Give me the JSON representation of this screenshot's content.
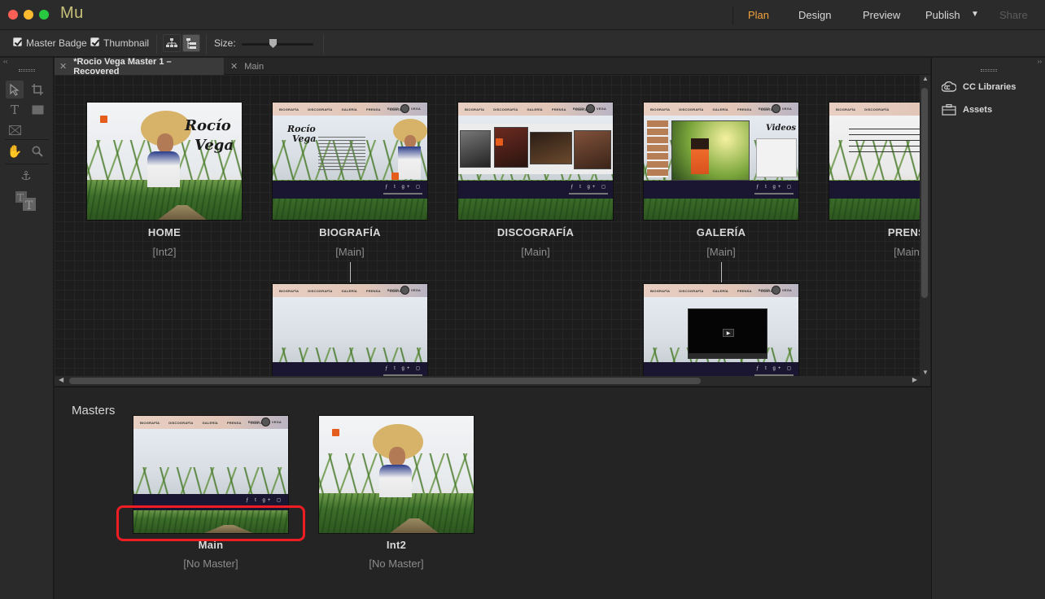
{
  "window": {
    "app_logo": "Mu",
    "nav": {
      "plan": "Plan",
      "design": "Design",
      "preview": "Preview",
      "publish": "Publish",
      "share": "Share"
    },
    "colors": {
      "active_nav": "#f3a23b",
      "highlight_box": "#ee1d24"
    }
  },
  "toolbar": {
    "master_badge_label": "Master Badge",
    "master_badge_checked": true,
    "thumbnail_label": "Thumbnail",
    "thumbnail_checked": true,
    "size_label": "Size:"
  },
  "tabs": [
    {
      "label": "*Rocio Vega Master 1 – Recovered",
      "active": true
    },
    {
      "label": "Main",
      "active": false
    }
  ],
  "right_panel": {
    "items": [
      {
        "label": "CC Libraries",
        "icon": "cc-libraries-icon"
      },
      {
        "label": "Assets",
        "icon": "briefcase-icon"
      }
    ]
  },
  "plan": {
    "pages": [
      {
        "name": "HOME",
        "master": "[Int2]"
      },
      {
        "name": "BIOGRAFÍA",
        "master": "[Main]"
      },
      {
        "name": "DISCOGRAFÍA",
        "master": "[Main]"
      },
      {
        "name": "GALERÍA",
        "master": "[Main]"
      },
      {
        "name": "PRENS",
        "master": "[Main"
      }
    ],
    "site_nav": [
      "BIOGRAFÍA",
      "DISCOGRAFÍA",
      "GALERÍA",
      "PRENSA",
      "CONTACTO"
    ],
    "brand": {
      "rocio": "ROCÍO",
      "vega": "VEGA"
    },
    "home_title_line1": "Rocío",
    "home_title_line2": "Vega",
    "videos_label": "Videos"
  },
  "masters": {
    "title": "Masters",
    "items": [
      {
        "name": "Main",
        "master": "[No Master]"
      },
      {
        "name": "Int2",
        "master": "[No Master]"
      }
    ]
  }
}
